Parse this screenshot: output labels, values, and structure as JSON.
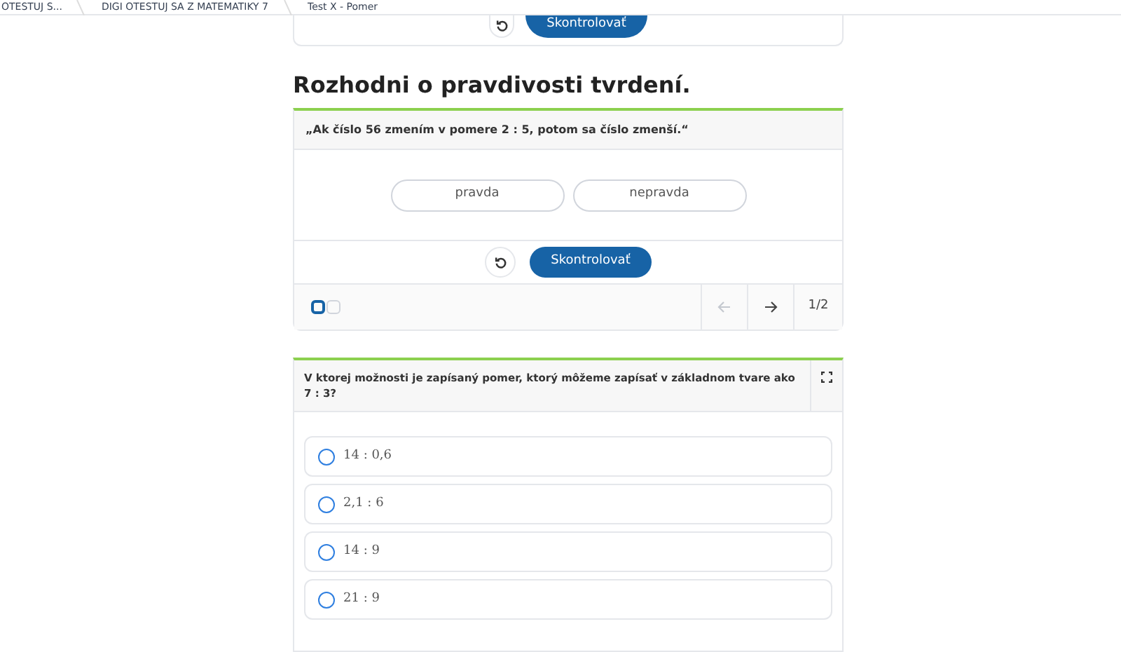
{
  "breadcrumbs": [
    {
      "label": "OTESTUJ S..."
    },
    {
      "label": "DIGI OTESTUJ SA Z MATEMATIKY 7"
    },
    {
      "label": "Test X - Pomer"
    }
  ],
  "previous_card": {
    "check_button": "Skontrolovať"
  },
  "section_title": "Rozhodni o pravdivosti tvrdení.",
  "true_false": {
    "statement": "„Ak číslo 56 zmením v pomere 2 : 5, potom sa číslo zmenší.“",
    "options": [
      {
        "label": "pravda",
        "selected": false
      },
      {
        "label": "nepravda",
        "selected": false
      }
    ],
    "check_button": "Skontrolovať",
    "pages": [
      {
        "selected": true
      },
      {
        "selected": false
      }
    ],
    "prev_disabled": true,
    "next_disabled": false,
    "page_counter": "1/2"
  },
  "choice": {
    "question": "V ktorej možnosti je zapísaný pomer, ktorý môžeme zapísať v základnom tvare ako 7 : 3?",
    "options": [
      {
        "label": "14 : 0,6",
        "selected": false
      },
      {
        "label": "2,1 : 6",
        "selected": false
      },
      {
        "label": "14 : 9",
        "selected": false
      },
      {
        "label": "21 : 9",
        "selected": false
      }
    ]
  }
}
